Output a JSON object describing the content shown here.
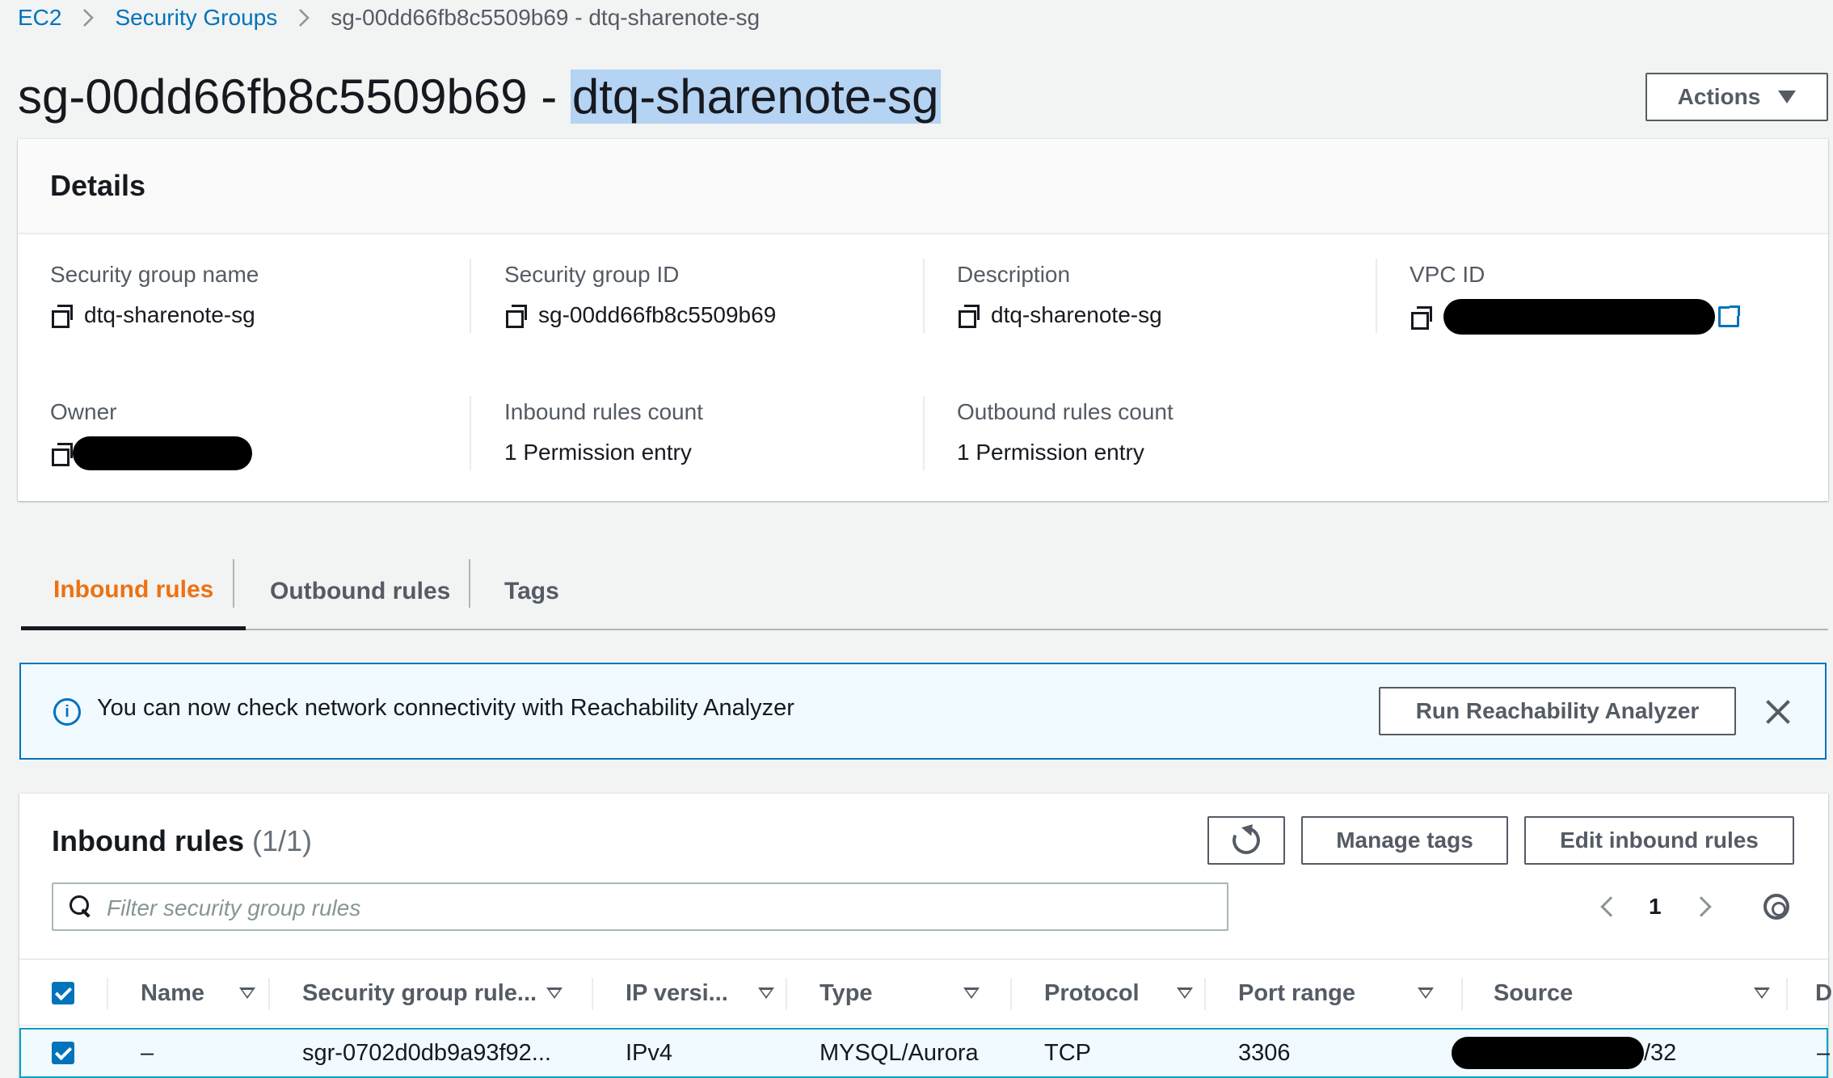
{
  "breadcrumb": {
    "items": [
      "EC2",
      "Security Groups",
      "sg-00dd66fb8c5509b69 - dtq-sharenote-sg"
    ]
  },
  "page": {
    "title_prefix": "sg-00dd66fb8c5509b69 - ",
    "title_highlight": "dtq-sharenote-sg",
    "actions_label": "Actions"
  },
  "details": {
    "heading": "Details",
    "sg_name": {
      "label": "Security group name",
      "value": "dtq-sharenote-sg"
    },
    "sg_id": {
      "label": "Security group ID",
      "value": "sg-00dd66fb8c5509b69"
    },
    "description": {
      "label": "Description",
      "value": "dtq-sharenote-sg"
    },
    "vpc_id": {
      "label": "VPC ID"
    },
    "owner": {
      "label": "Owner"
    },
    "inbound_count": {
      "label": "Inbound rules count",
      "value": "1 Permission entry"
    },
    "outbound_count": {
      "label": "Outbound rules count",
      "value": "1 Permission entry"
    }
  },
  "tabs": [
    {
      "label": "Inbound rules",
      "active": true
    },
    {
      "label": "Outbound rules",
      "active": false
    },
    {
      "label": "Tags",
      "active": false
    }
  ],
  "banner": {
    "message": "You can now check network connectivity with Reachability Analyzer",
    "button_label": "Run Reachability Analyzer"
  },
  "rules": {
    "heading": "Inbound rules",
    "count": "(1/1)",
    "manage_tags_label": "Manage tags",
    "edit_label": "Edit inbound rules",
    "filter_placeholder": "Filter security group rules",
    "page_number": "1",
    "columns": [
      "Name",
      "Security group rule...",
      "IP versi...",
      "Type",
      "Protocol",
      "Port range",
      "Source",
      "D"
    ],
    "rows": [
      {
        "name": "–",
        "rule_id": "sgr-0702d0db9a93f92...",
        "ip_version": "IPv4",
        "type": "MYSQL/Aurora",
        "protocol": "TCP",
        "port_range": "3306",
        "source_suffix": "/32",
        "extra": "–"
      }
    ]
  },
  "colors": {
    "link": "#0073bb",
    "active_tab": "#ec7211",
    "title_highlight": "#b5d3f3",
    "banner_bg": "#f1faff"
  }
}
